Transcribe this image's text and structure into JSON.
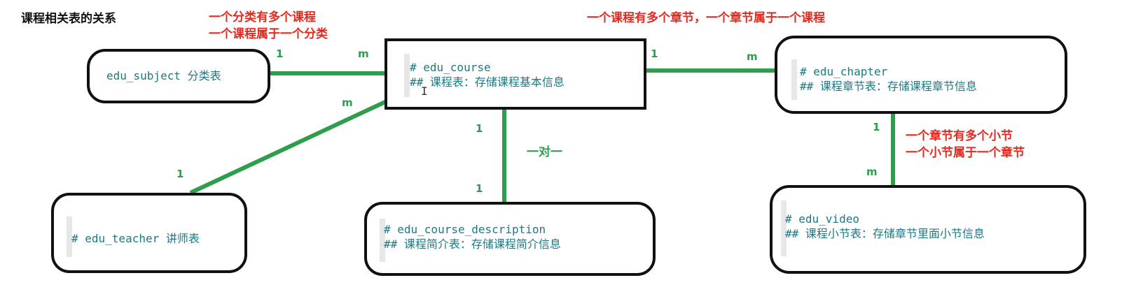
{
  "title": "课程相关表的关系",
  "tables": {
    "subject": {
      "line1": "edu_subject 分类表"
    },
    "course": {
      "line1": "# edu_course",
      "line2": "## 课程表：存储课程基本信息"
    },
    "chapter": {
      "line1": "# edu_chapter",
      "line2": "## 课程章节表：存储课程章节信息"
    },
    "teacher": {
      "line1": "# edu_teacher 讲师表"
    },
    "description": {
      "line1": "# edu_course_description",
      "line2": "## 课程简介表：存储课程简介信息"
    },
    "video": {
      "line1": "# edu_video",
      "line2": "## 课程小节表：存储章节里面小节信息"
    }
  },
  "notes": {
    "subject_course_1": "一个分类有多个课程",
    "subject_course_2": "一个课程属于一个分类",
    "course_chapter": "一个课程有多个章节，一个章节属于一个课程",
    "chapter_video_1": "一个章节有多个小节",
    "chapter_video_2": "一个小节属于一个章节",
    "course_description": "一对一"
  },
  "cardinalities": {
    "subject_side": "1",
    "course_side_subject": "m",
    "course_side_chapter": "1",
    "chapter_side_course": "m",
    "course_side_teacher": "m",
    "teacher_side": "1",
    "course_side_description": "1",
    "description_side": "1",
    "chapter_side_video": "1",
    "video_side": "m"
  },
  "colors": {
    "relation_line": "#2e9d4c",
    "note_text": "#e02a1f",
    "table_text": "#1a7a84",
    "box_border": "#111111"
  }
}
